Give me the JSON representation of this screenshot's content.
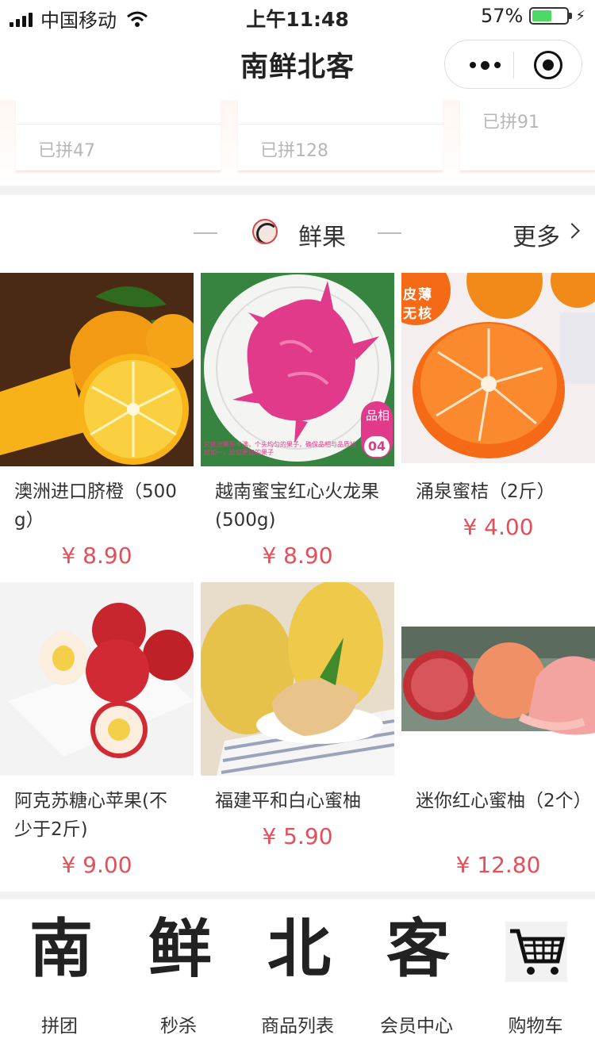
{
  "status_bar": {
    "carrier": "中国移动",
    "time": "上午11:48",
    "battery_percent": "57%",
    "battery_level": 0.57
  },
  "navbar": {
    "title": "南鲜北客",
    "more_icon": "more-dots-icon",
    "close_icon": "target-circle-icon"
  },
  "group_buy": {
    "cards": [
      {
        "joined": "已拼47"
      },
      {
        "joined": "已拼128"
      },
      {
        "joined": "已拼91"
      }
    ]
  },
  "section": {
    "title": "鲜果",
    "more": "更多"
  },
  "products": [
    {
      "name": "澳洲进口脐橙（500g）",
      "price": "¥ 8.90",
      "image": "navel-orange-photo"
    },
    {
      "name": "越南蜜宝红心火龙果(500g)",
      "price": "¥ 8.90",
      "image": "dragon-fruit-photo",
      "badge_top": "品相",
      "badge_num": "04",
      "caption": "只挑选果形丰满，个头均匀的果子，确保品相与品质始终如一，给您更好的果子"
    },
    {
      "name": "涌泉蜜桔（2斤）",
      "price": "¥ 4.00",
      "image": "tangerine-photo",
      "tag": "皮薄无核"
    },
    {
      "name": "阿克苏糖心苹果(不少于2斤)",
      "price": "¥ 9.00",
      "image": "apple-photo"
    },
    {
      "name": "福建平和白心蜜柚",
      "price": "¥ 5.90",
      "image": "pomelo-photo"
    },
    {
      "name": "迷你红心蜜柚（2个）",
      "price": "¥ 12.80",
      "image": "red-pomelo-photo"
    }
  ],
  "bottom_menu": [
    {
      "glyph": "南",
      "label": "拼团"
    },
    {
      "glyph": "鲜",
      "label": "秒杀"
    },
    {
      "glyph": "北",
      "label": "商品列表"
    },
    {
      "glyph": "客",
      "label": "会员中心"
    },
    {
      "glyph": "",
      "label": "购物车",
      "icon": "shopping-cart-icon"
    }
  ],
  "colors": {
    "price": "#e2505a",
    "accent": "#d44",
    "battery": "#4cd964"
  }
}
